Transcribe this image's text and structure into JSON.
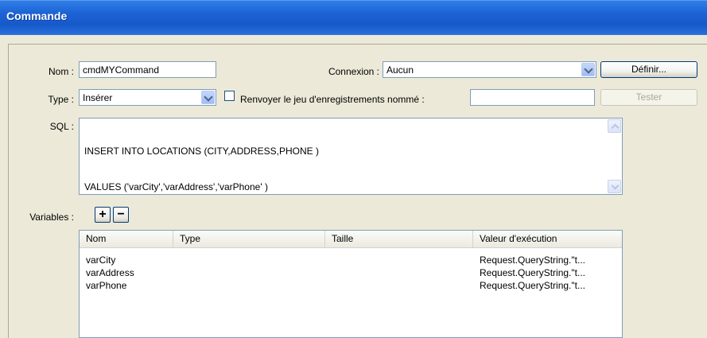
{
  "window": {
    "title": "Commande"
  },
  "form": {
    "nom_label": "Nom :",
    "nom_value": "cmdMYCommand",
    "connexion_label": "Connexion :",
    "connexion_value": "Aucun",
    "definir_button": "Définir...",
    "type_label": "Type :",
    "type_value": "Insérer",
    "renvoyer_label": "Renvoyer le jeu d'enregistrements nommé :",
    "renvoyer_value": "",
    "renvoyer_checked": false,
    "tester_button": "Tester",
    "sql_label": "SQL :",
    "sql_lines": [
      "INSERT INTO LOCATIONS (CITY,ADDRESS,PHONE )",
      "VALUES ('varCity','varAddress','varPhone' )"
    ],
    "variables_label": "Variables :",
    "add_symbol": "+",
    "remove_symbol": "−"
  },
  "variables_table": {
    "columns": [
      "Nom",
      "Type",
      "Taille",
      "Valeur d'exécution"
    ],
    "rows": [
      [
        "varCity",
        "",
        "",
        "Request.QueryString.\"t..."
      ],
      [
        "varAddress",
        "",
        "",
        "Request.QueryString.\"t..."
      ],
      [
        "varPhone",
        "",
        "",
        "Request.QueryString.\"t..."
      ]
    ]
  }
}
